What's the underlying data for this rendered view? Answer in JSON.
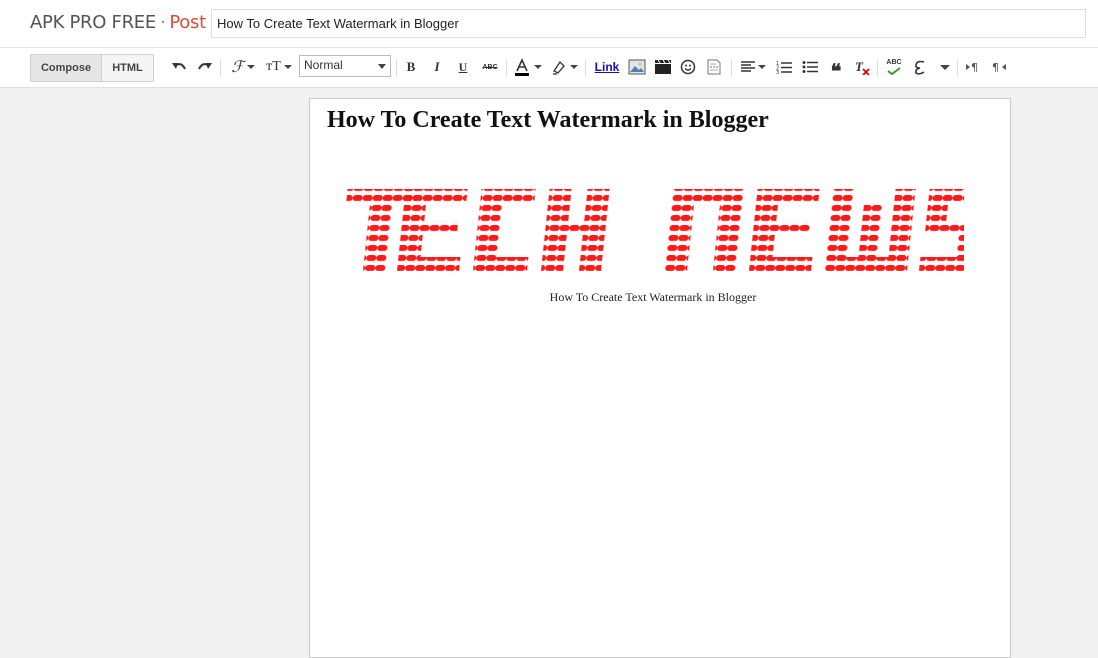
{
  "header": {
    "blog_name": "APK PRO FREE",
    "separator": "·",
    "section": "Post",
    "title_value": "How To Create Text Watermark in Blogger"
  },
  "toolbar": {
    "compose_label": "Compose",
    "html_label": "HTML",
    "format_value": "Normal",
    "bold_label": "B",
    "italic_label": "I",
    "underline_label": "U",
    "strike_label": "ABC",
    "link_label": "Link",
    "spell_label": "ABC"
  },
  "editor": {
    "heading": "How To Create Text Watermark in Blogger",
    "logo_text": "TECH  NEWS",
    "caption": "How To Create Text Watermark in Blogger"
  },
  "colors": {
    "accent": "#dd4b39",
    "logo_red": "#ff1a1a"
  }
}
